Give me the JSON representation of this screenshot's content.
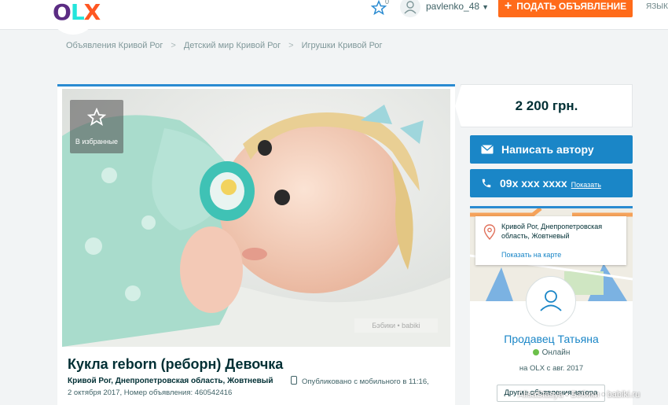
{
  "header": {
    "logo_text": [
      "O",
      "L",
      "X"
    ],
    "favorites_count": "0",
    "username": "pavlenko_48",
    "post_button_label": "ПОДАТЬ ОБЪЯВЛЕНИЕ",
    "language_label": "ЯЗЫК"
  },
  "breadcrumb": [
    "Объявления Кривой Рог",
    "Детский мир Кривой Рог",
    "Игрушки Кривой Рог"
  ],
  "listing": {
    "favorite_label": "В избранные",
    "photo_watermark": "Бэбики • babiki",
    "title": "Кукла reborn (реборн) Девочка",
    "location": "Кривой Рог, Днепропетровская область, Жовтневый",
    "published": "Опубликовано с мобильного   в 11:16,",
    "published_date_id": "2 октября 2017, Номер объявления: 460542416"
  },
  "sidebar": {
    "price": "2 200 грн.",
    "message_button": "Написать автору",
    "phone": "09x xxx xxxx",
    "phone_show": "Показать",
    "address": "Кривой Рог, Днепропетровская область, Жовтневый",
    "map_link": "Показать на карте",
    "seller_name": "Продавец Татьяна",
    "online_status": "Онлайн",
    "member_since": "на OLX с авг. 2017",
    "other_ads_button": "Другие объявления автора"
  },
  "footer_watermark": "AlisaStasya • Бэбики • babiki.ru",
  "colors": {
    "accent_blue": "#1a86c7",
    "post_orange": "#ff6b1a",
    "online_green": "#6cc04a",
    "text_dark": "#002f34"
  }
}
